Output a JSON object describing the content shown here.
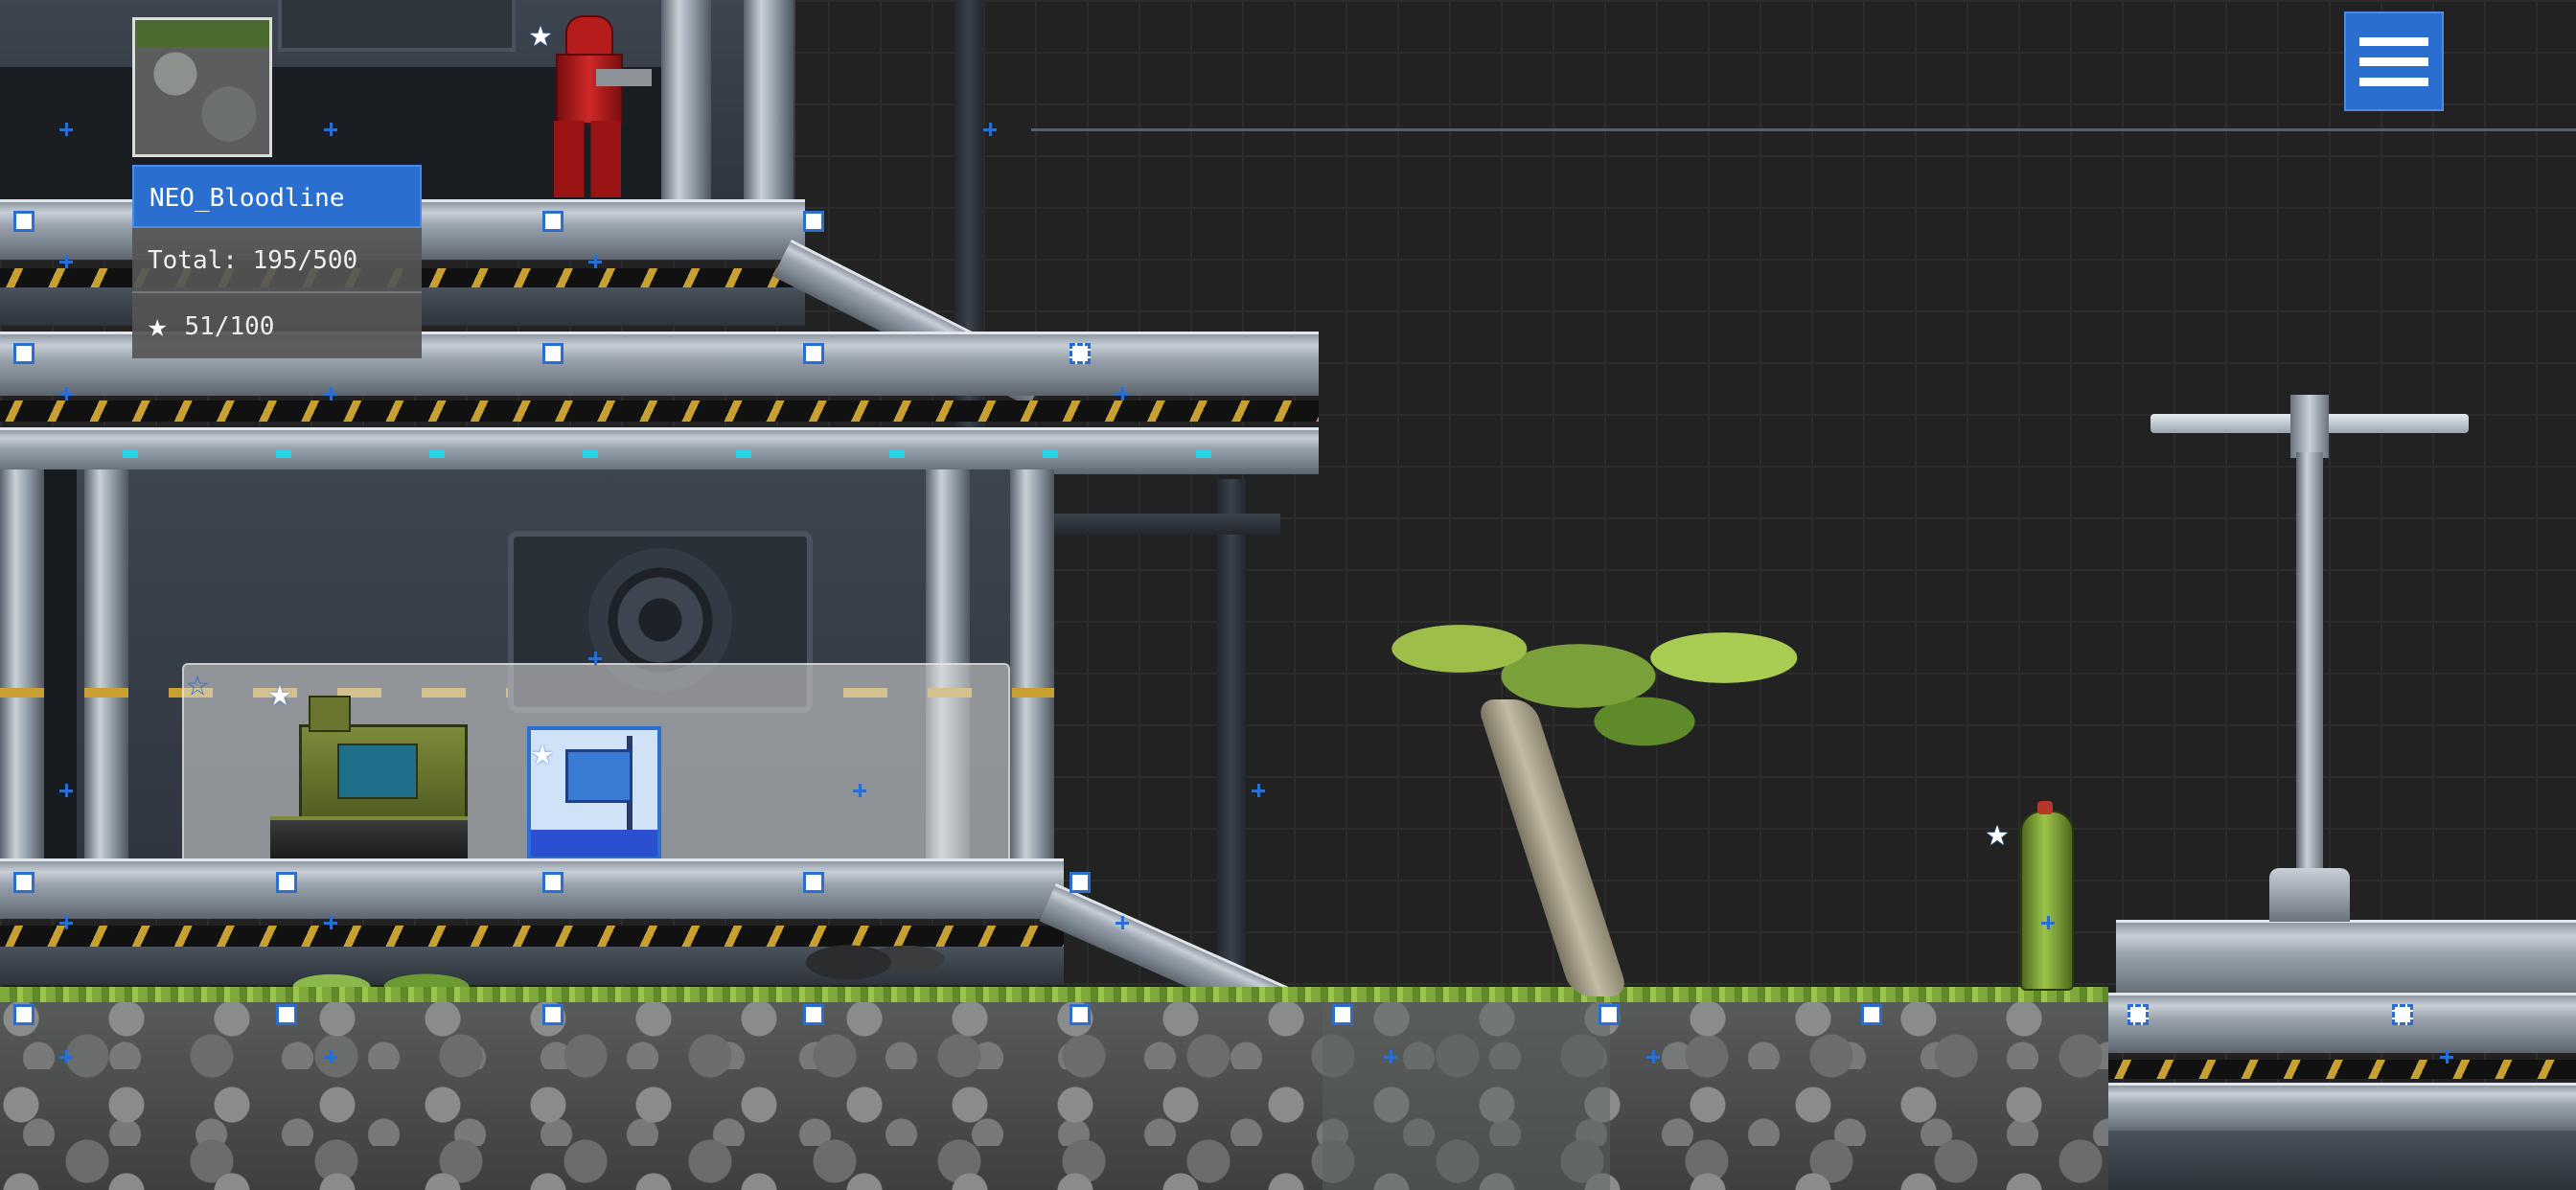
{
  "hud": {
    "player_name": "NEO_Bloodline",
    "total_label": "Total:",
    "total_value": "195/500",
    "stars_value": "51/100",
    "star_icon": "star-icon",
    "avatar_icon": "mossy-rock-avatar-icon"
  },
  "menu": {
    "icon": "hamburger-menu-icon"
  },
  "colors": {
    "accent": "#2a6fcf",
    "panel": "#555555",
    "moss": "#7fa83a",
    "hazard_yellow": "#c8a032",
    "cyan_light": "#27d6e8"
  },
  "scene": {
    "objects": [
      "red-armored-soldier",
      "military-generator-tank",
      "blue-flag-block",
      "bonsai-tree",
      "green-gas-canister",
      "street-lamp",
      "mossy-rock-ground",
      "metal-platforms"
    ]
  }
}
